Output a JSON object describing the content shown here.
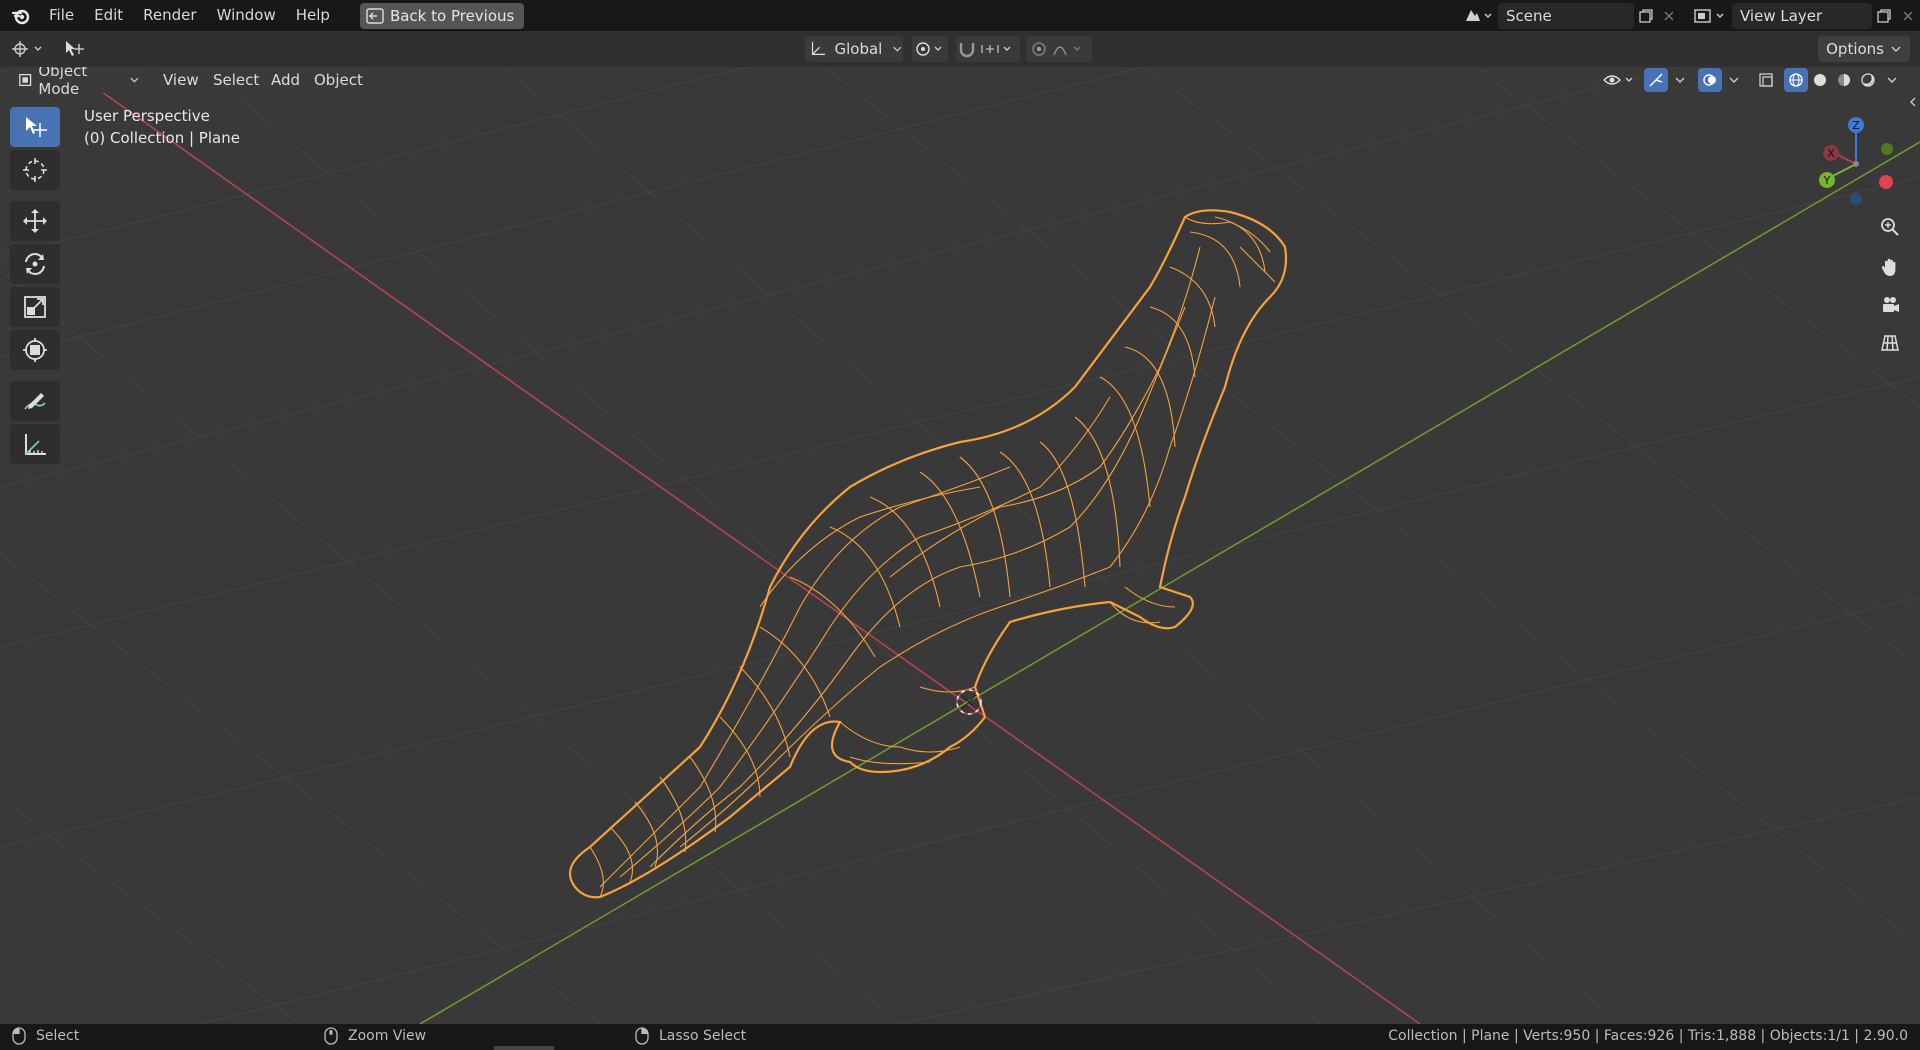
{
  "menubar": {
    "items": [
      "File",
      "Edit",
      "Render",
      "Window",
      "Help"
    ],
    "back_label": "Back to Previous",
    "scene_name": "Scene",
    "view_layer_name": "View Layer"
  },
  "header": {
    "orientation": "Global",
    "options_label": "Options"
  },
  "viewport_header": {
    "mode": "Object Mode",
    "menus": [
      "View",
      "Select",
      "Add",
      "Object"
    ]
  },
  "viewport": {
    "perspective_label": "User Perspective",
    "collection_label": "(0) Collection | Plane",
    "gizmo_axes": {
      "x": "X",
      "y": "Y",
      "z": "Z"
    },
    "colors": {
      "background": "#393939",
      "grid": "#4a4a4a",
      "x_axis": "#b8434f",
      "y_axis": "#6b9a2d",
      "selection": "#f5a23c",
      "active_tool": "#4772b3"
    }
  },
  "toolbar": {
    "tools": [
      "select-box",
      "cursor",
      "move",
      "rotate",
      "scale",
      "transform",
      "annotate",
      "measure"
    ]
  },
  "statusbar": {
    "select_label": "Select",
    "zoom_label": "Zoom View",
    "lasso_label": "Lasso Select",
    "stats": "Collection | Plane | Verts:950 | Faces:926 | Tris:1,888 | Objects:1/1 | 2.90.0"
  }
}
